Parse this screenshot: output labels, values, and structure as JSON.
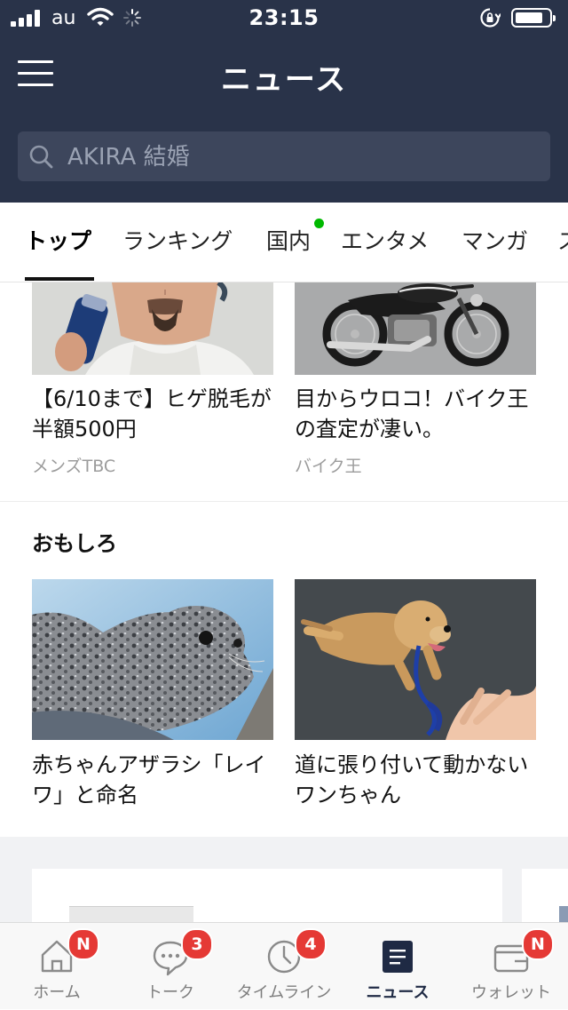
{
  "status_bar": {
    "carrier": "au",
    "time": "23:15"
  },
  "header": {
    "title": "ニュース",
    "search_placeholder": "AKIRA 結婚"
  },
  "tabs": [
    {
      "label": "トップ",
      "active": true
    },
    {
      "label": "ランキング"
    },
    {
      "label": "国内",
      "has_dot": true
    },
    {
      "label": "エンタメ"
    },
    {
      "label": "マンガ"
    },
    {
      "label": "ス"
    }
  ],
  "colors": {
    "header_bg": "#293349",
    "dot": "#00b900",
    "badge": "#e53935"
  },
  "top_cards": [
    {
      "headline": "【6/10まで】ヒゲ脱毛が半額500円",
      "source": "メンズTBC",
      "image": "man-shaving-photo"
    },
    {
      "headline": "目からウロコ！バイク王の査定が凄い。",
      "source": "バイク王",
      "image": "motorcycle-photo"
    }
  ],
  "section": {
    "title": "おもしろ",
    "cards": [
      {
        "headline": "赤ちゃんアザラシ「レイワ」と命名",
        "image": "baby-seal-photo"
      },
      {
        "headline": "道に張り付いて動かないワンちゃん",
        "image": "golden-retriever-photo"
      }
    ]
  },
  "bottom_nav": [
    {
      "label": "ホーム",
      "icon": "home-icon",
      "badge": "N"
    },
    {
      "label": "トーク",
      "icon": "chat-bubble-icon",
      "badge": "3"
    },
    {
      "label": "タイムライン",
      "icon": "clock-icon",
      "badge": "4"
    },
    {
      "label": "ニュース",
      "icon": "news-icon",
      "active": true
    },
    {
      "label": "ウォレット",
      "icon": "wallet-icon",
      "badge": "N"
    }
  ]
}
